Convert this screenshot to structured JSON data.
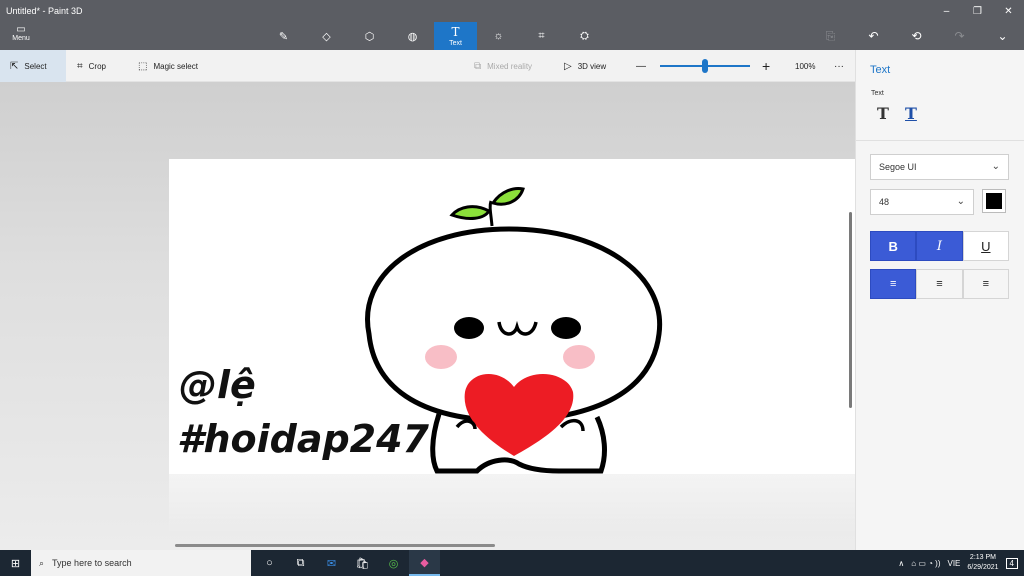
{
  "window": {
    "title": "Untitled* - Paint 3D",
    "min": "–",
    "max": "❐",
    "close": "✕"
  },
  "toolbar": {
    "menu_label": "Menu",
    "menu_icon": "▭",
    "tools": [
      {
        "name": "brushes",
        "icon": "✎"
      },
      {
        "name": "2d-shapes",
        "icon": "◇"
      },
      {
        "name": "3d-shapes",
        "icon": "⬡"
      },
      {
        "name": "stickers",
        "icon": "◍"
      },
      {
        "name": "text",
        "icon": "T",
        "label": "Text"
      },
      {
        "name": "effects",
        "icon": "☼"
      },
      {
        "name": "canvas",
        "icon": "⌗"
      },
      {
        "name": "3d-library",
        "icon": "⛭"
      }
    ],
    "right": {
      "paste": "⎘",
      "undo": "↶",
      "history": "⟲",
      "redo": "↷",
      "expand": "⌄"
    }
  },
  "subbar": {
    "select": "Select",
    "select_icon": "⇱",
    "crop": "Crop",
    "crop_icon": "⌗",
    "magic_select": "Magic select",
    "magic_icon": "⬚",
    "mixed_reality": "Mixed reality",
    "mr_icon": "⧉",
    "view3d": "3D view",
    "view3d_icon": "▷",
    "zoom_minus": "—",
    "zoom_plus": "+",
    "zoom": "100%",
    "zoom_level": 0.5,
    "more": "···"
  },
  "canvas": {
    "line1": "@lệ",
    "line2": "#hoidap247"
  },
  "panel": {
    "title": "Text",
    "section": "Text",
    "type_2d": "T",
    "type_3d": "T",
    "font": "Segoe UI",
    "size": "48",
    "chevron": "⌄",
    "color": "#000000",
    "bold": "B",
    "italic": "I",
    "underline": "U",
    "align_left": "≡",
    "align_center": "≡",
    "align_right": "≡"
  },
  "taskbar": {
    "start": "⊞",
    "search_icon": "⌕",
    "search": "Type here to search",
    "apps": [
      "○",
      "⧉",
      "✉",
      "🛍",
      "◎",
      "◆"
    ],
    "tray": {
      "up": "∧",
      "icons": "⌂ ▭ ◔ ))",
      "lang": "VIE",
      "time": "2:13 PM",
      "date": "6/29/2021",
      "notify": "4"
    }
  }
}
